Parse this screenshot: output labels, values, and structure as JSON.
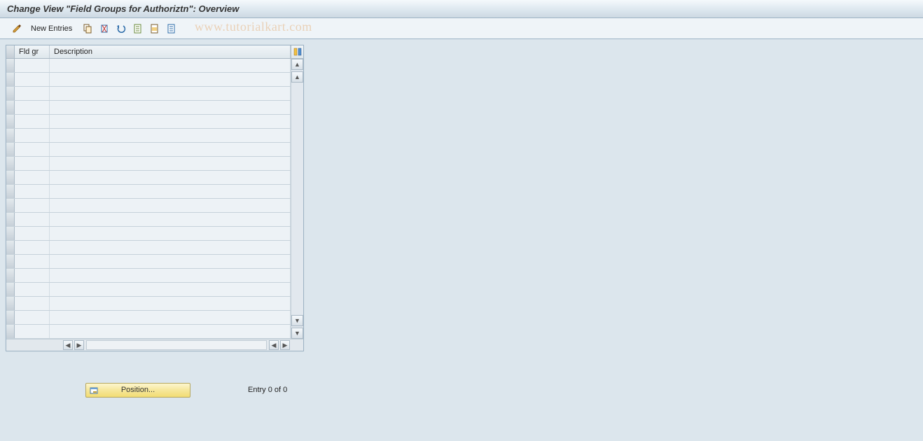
{
  "header": {
    "title": "Change View \"Field Groups for Authoriztn\": Overview"
  },
  "toolbar": {
    "new_entries_label": "New Entries"
  },
  "watermark": {
    "text": "www.tutorialkart.com"
  },
  "table": {
    "columns": {
      "fld_gr": "Fld gr",
      "description": "Description"
    },
    "row_count": 20
  },
  "footer": {
    "position_label": "Position...",
    "entry_status": "Entry 0 of 0"
  }
}
